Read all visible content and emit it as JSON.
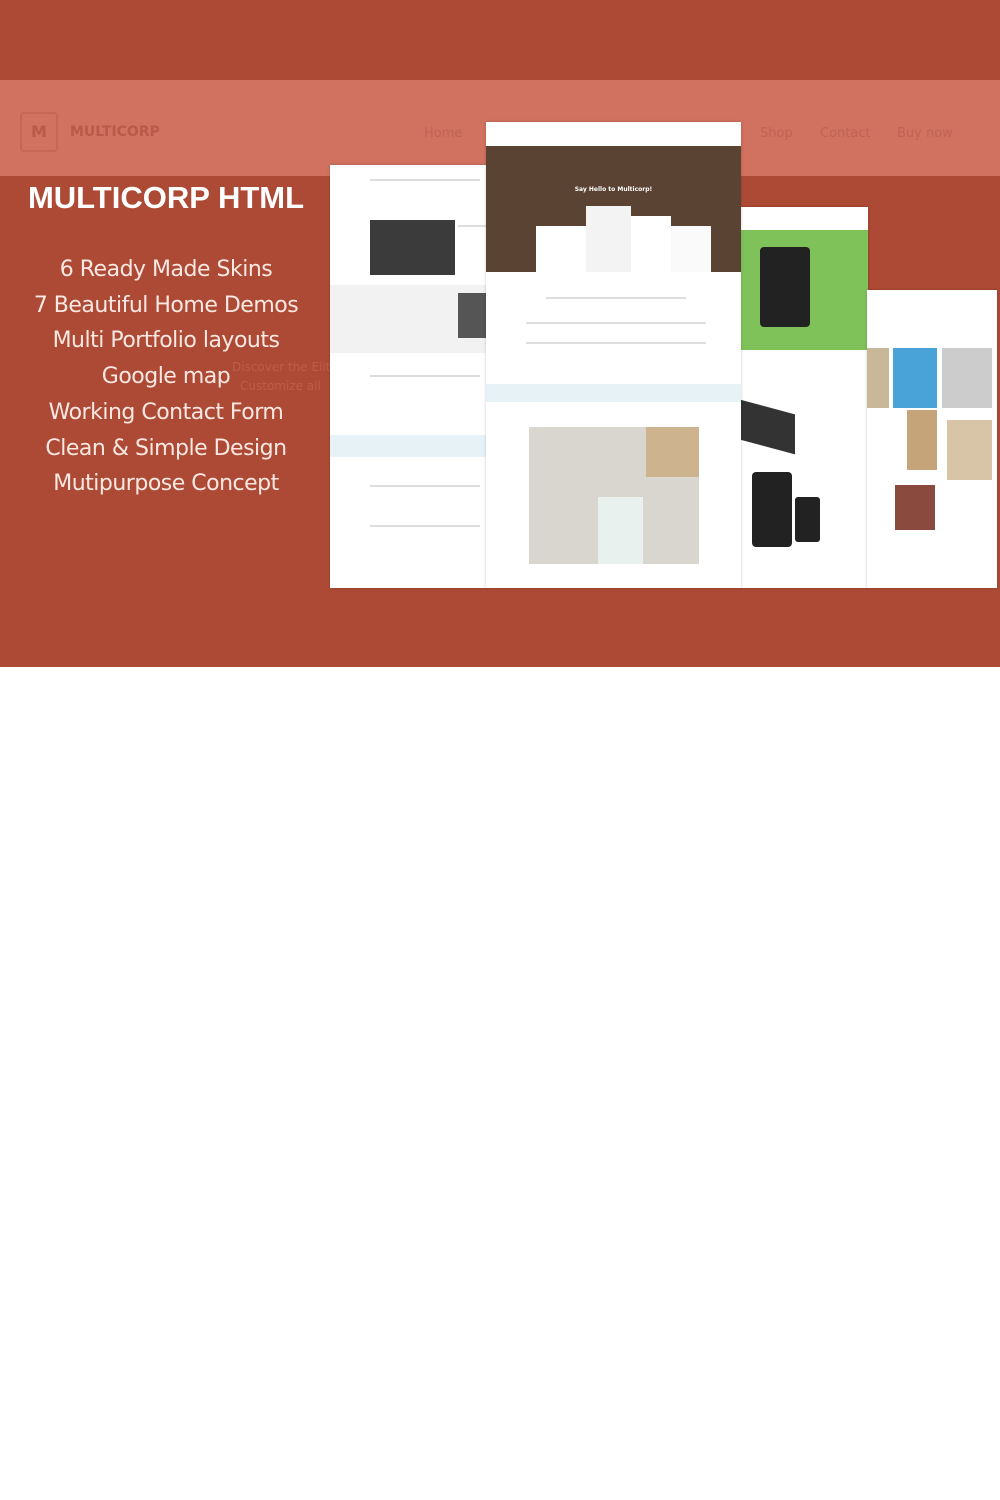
{
  "header": {
    "logo_letter": "M",
    "logo_text": "MULTICORP",
    "nav": [
      "Home",
      "Shop",
      "Contact",
      "Buy now"
    ]
  },
  "promo": {
    "title": "MULTICORP HTML",
    "features": [
      "6 Ready Made Skins",
      "7 Beautiful Home Demos",
      "Multi Portfolio layouts",
      "Google map",
      "Working Contact Form",
      "Clean & Simple Design",
      "Mutipurpose Concept"
    ],
    "faint_text": [
      "Discover the Elite be",
      "Customize all"
    ]
  },
  "mockup": {
    "hero_title": "Say Hello to Multicorp!"
  },
  "colors": {
    "banner": "#ad4a35",
    "header_band": "#d17160",
    "hero_brown": "#5a4332",
    "hero_green": "#7fc25a"
  }
}
